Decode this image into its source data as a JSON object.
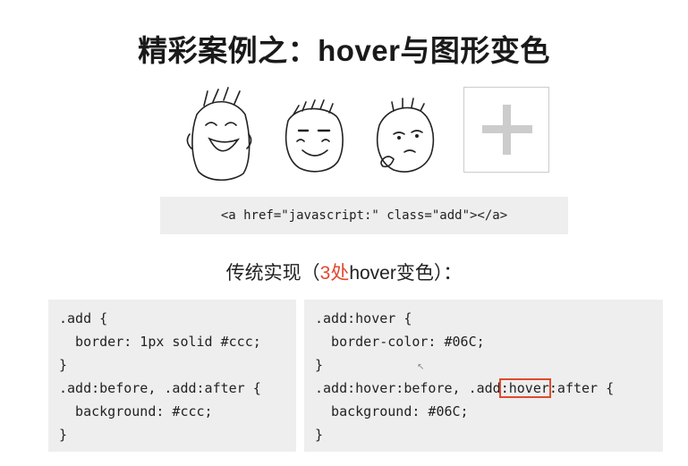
{
  "title": "精彩案例之：hover与图形变色",
  "code_line": "<a href=\"javascript:\" class=\"add\"></a>",
  "subtitle": {
    "before": "传统实现（",
    "highlight": "3处",
    "after": "hover变色）："
  },
  "code_left": [
    ".add {",
    "  border: 1px solid #ccc;",
    "}",
    ".add:before, .add:after {",
    "  background: #ccc;",
    "}"
  ],
  "code_right": [
    ".add:hover {",
    "  border-color: #06C;",
    "}",
    {
      "a": ".add:hover:before, .add",
      "b": ":hover",
      "c": ":after {"
    },
    "  background: #06C;",
    "}"
  ],
  "colors": {
    "accent": "#e04a2f",
    "code_bg": "#eeeeee",
    "plus": "#cccccc"
  },
  "icons": [
    "laughing-face-icon",
    "grinning-face-icon",
    "pondering-face-icon",
    "add-plus-icon"
  ]
}
